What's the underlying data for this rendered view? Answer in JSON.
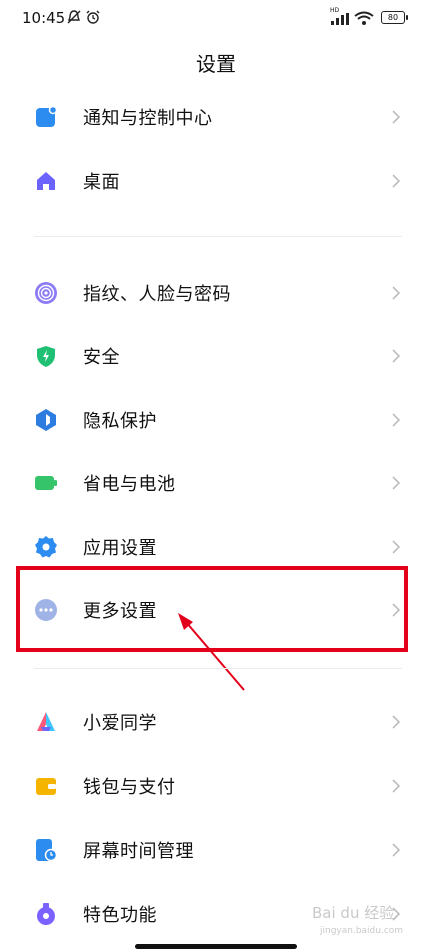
{
  "status_bar": {
    "time": "10:45",
    "hd_label": "HD",
    "battery": "80"
  },
  "page": {
    "title": "设置"
  },
  "settings_items": [
    {
      "label": "通知与控制中心",
      "icon": "notification-icon",
      "color": "#2d8cf0"
    },
    {
      "label": "桌面",
      "icon": "home-icon",
      "color": "#6c63ff"
    },
    {
      "label": "指纹、人脸与密码",
      "icon": "fingerprint-icon",
      "color": "#8b7cf6"
    },
    {
      "label": "安全",
      "icon": "shield-icon",
      "color": "#1fbf74"
    },
    {
      "label": "隐私保护",
      "icon": "privacy-icon",
      "color": "#2d7de0"
    },
    {
      "label": "省电与电池",
      "icon": "battery-icon",
      "color": "#35c46a"
    },
    {
      "label": "应用设置",
      "icon": "gear-icon",
      "color": "#2d8cf0"
    },
    {
      "label": "更多设置",
      "icon": "more-icon",
      "color": "#9fb3e6"
    },
    {
      "label": "小爱同学",
      "icon": "xiaoai-icon",
      "color": "#ff5a5a"
    },
    {
      "label": "钱包与支付",
      "icon": "wallet-icon",
      "color": "#f4b400"
    },
    {
      "label": "屏幕时间管理",
      "icon": "screen-time-icon",
      "color": "#2d8cf0"
    },
    {
      "label": "特色功能",
      "icon": "feature-icon",
      "color": "#7b61ff"
    }
  ],
  "watermark": {
    "text": "Bai du 经验",
    "sub": "jingyan.baidu.com"
  },
  "accent_colors": {
    "highlight": "#e3001b"
  }
}
